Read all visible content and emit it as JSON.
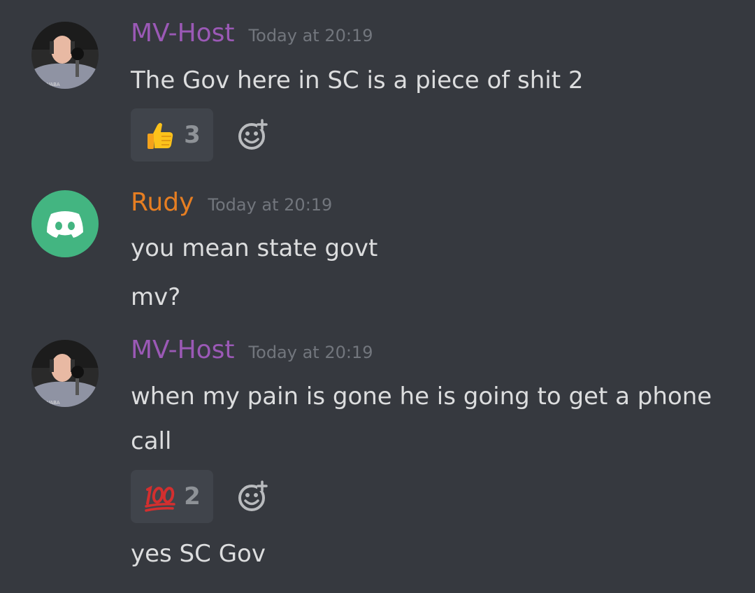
{
  "messages": [
    {
      "author": "MV-Host",
      "author_color": "#9b59b6",
      "timestamp": "Today at 20:19",
      "lines": [
        "The Gov here in SC is a piece of shit 2"
      ],
      "reaction": {
        "emoji": "thumbs-up-emoji",
        "count": "3"
      }
    },
    {
      "author": "Rudy",
      "author_color": "#e67e22",
      "timestamp": "Today at 20:19",
      "lines": [
        "you mean state govt",
        "mv?"
      ]
    },
    {
      "author": "MV-Host",
      "author_color": "#9b59b6",
      "timestamp": "Today at 20:19",
      "lines": [
        "when my pain is gone he is going to get a phone",
        "call"
      ],
      "reaction": {
        "emoji": "hundred-points-emoji",
        "count": "2"
      },
      "followup": "yes SC Gov"
    }
  ],
  "colors": {
    "background": "#36393f",
    "text": "#dcddde",
    "timestamp": "#72767d",
    "reaction_bg": "#40444b",
    "discord_avatar_bg": "#43b581"
  },
  "icons": {
    "add_reaction": "add-reaction-icon",
    "discord_avatar": "discord-logo-icon"
  }
}
